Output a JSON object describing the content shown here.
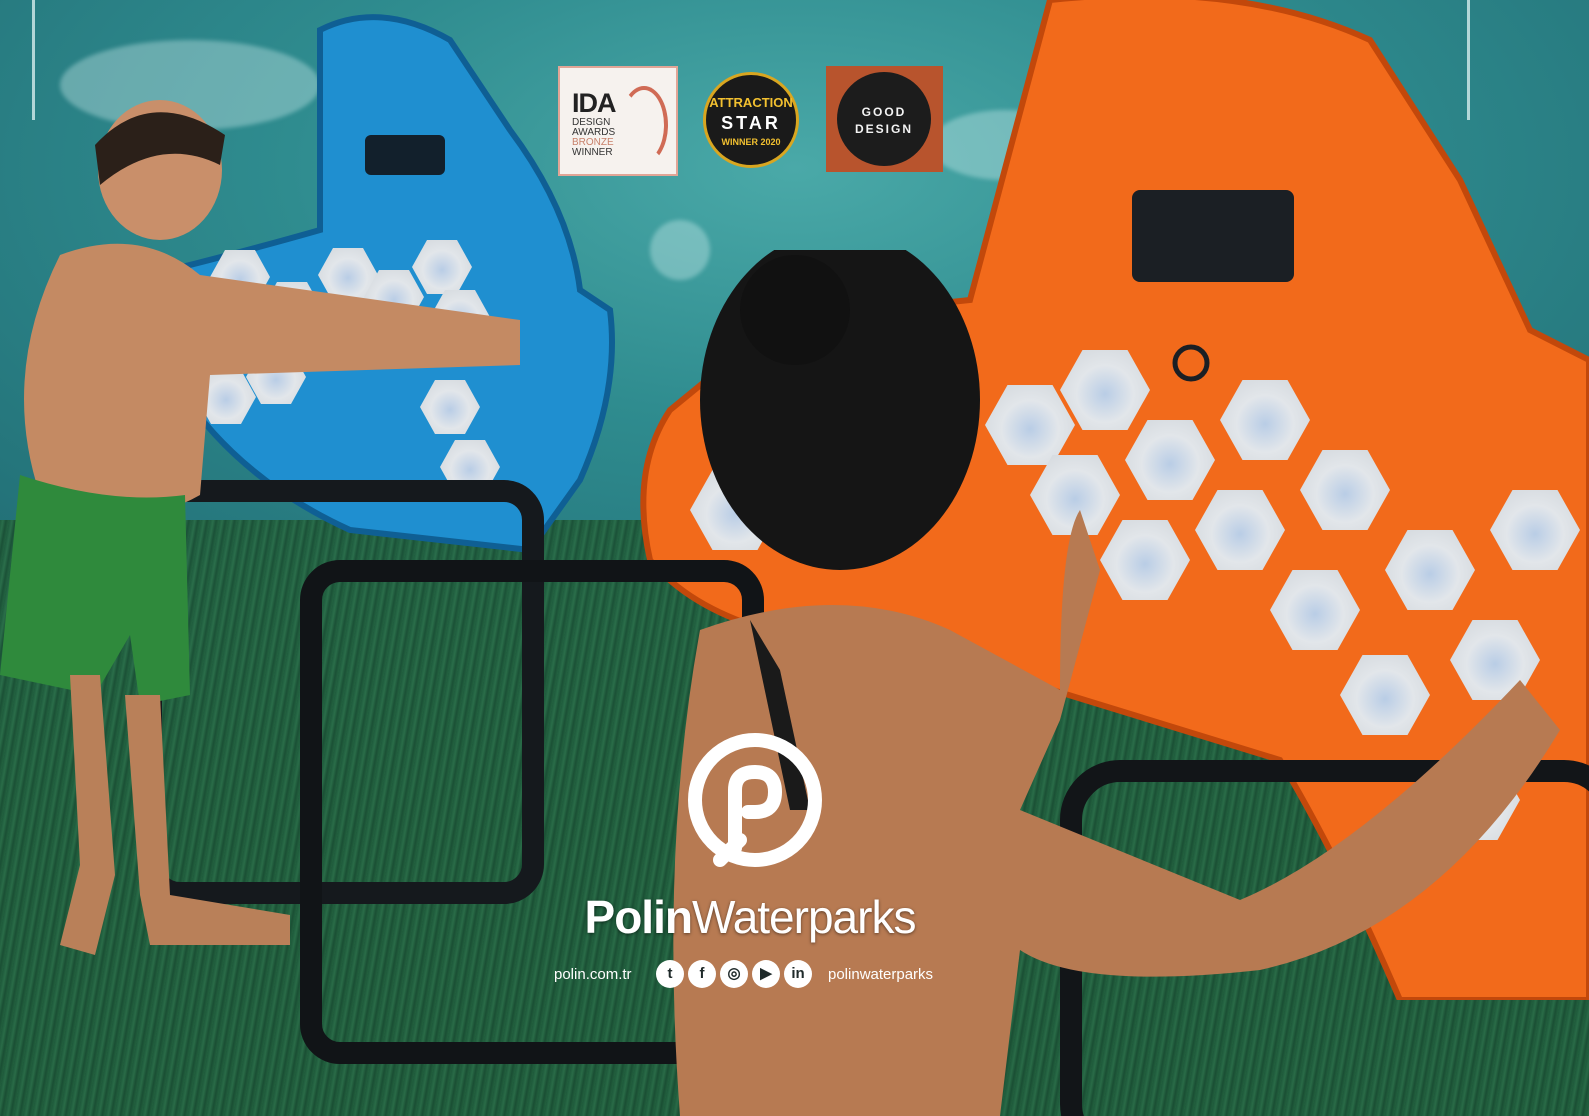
{
  "brand": {
    "name_bold": "Polin",
    "name_regular": "Waterparks",
    "website": "polin.com.tr",
    "handle": "polinwaterparks",
    "social_icons": [
      "twitter-icon",
      "facebook-icon",
      "instagram-icon",
      "youtube-icon",
      "linkedin-icon"
    ],
    "social_glyphs": [
      "t",
      "f",
      "◎",
      "▶",
      "in"
    ]
  },
  "awards": {
    "ida": {
      "title": "IDA",
      "line1": "DESIGN",
      "line2": "AWARDS",
      "line3": "BRONZE",
      "line4": "WINNER"
    },
    "attraction_star": {
      "line1": "ATTRACTION",
      "line2": "STAR",
      "line3": "WINNER 2020"
    },
    "good_design": {
      "line1": "GOOD",
      "line2": "DESIGN"
    }
  },
  "colors": {
    "teal_background": "#2f8c8f",
    "blue_panel": "#1f8fd0",
    "orange_panel": "#f26a1b",
    "frame": "#1b2126",
    "award_good_design": "#b8542d"
  }
}
